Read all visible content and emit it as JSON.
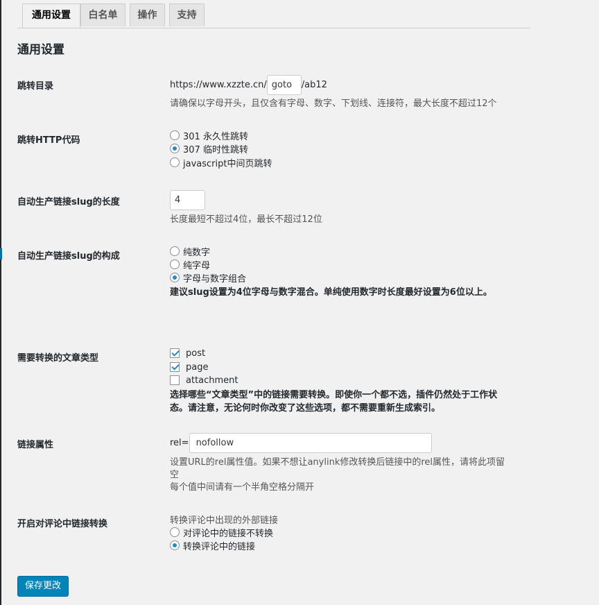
{
  "tabs": [
    {
      "label": "通用设置"
    },
    {
      "label": "白名单"
    },
    {
      "label": "操作"
    },
    {
      "label": "支持"
    }
  ],
  "page_title": "通用设置",
  "redirect_dir": {
    "label": "跳转目录",
    "prefix": "https://www.xzzte.cn/",
    "value": "goto",
    "suffix": "/ab12",
    "hint": "请确保以字母开头，且仅含有字母、数字、下划线、连接符，最大长度不超过12个"
  },
  "http_code": {
    "label": "跳转HTTP代码",
    "options": [
      {
        "label": "301 永久性跳转",
        "checked": false
      },
      {
        "label": "307 临时性跳转",
        "checked": true
      },
      {
        "label": "javascript中间页跳转",
        "checked": false
      }
    ]
  },
  "slug_length": {
    "label": "自动生产链接slug的长度",
    "value": "4",
    "hint": "长度最短不超过4位，最长不超过12位"
  },
  "slug_compose": {
    "label": "自动生产链接slug的构成",
    "options": [
      {
        "label": "纯数字",
        "checked": false
      },
      {
        "label": "纯字母",
        "checked": false
      },
      {
        "label": "字母与数字组合",
        "checked": true
      }
    ],
    "hint": "建议slug设置为4位字母与数字混合。单纯使用数字时长度最好设置为6位以上。"
  },
  "post_types": {
    "label": "需要转换的文章类型",
    "options": [
      {
        "label": "post",
        "checked": true
      },
      {
        "label": "page",
        "checked": true
      },
      {
        "label": "attachment",
        "checked": false
      }
    ],
    "hint_line1": "选择哪些“文章类型”中的链接需要转换。即使你一个都不选，插件仍然处于工作状",
    "hint_line2": "态。请注意，无论何时你改变了这些选项，都不需要重新生成索引。"
  },
  "link_rel": {
    "label": "链接属性",
    "prefix": "rel=",
    "value": "nofollow",
    "hint_line1": "设置URL的rel属性值。如果不想让anylink修改转换后链接中的rel属性，请将此项留",
    "hint_line2": "空",
    "hint_line3": "每个值中间请有一个半角空格分隔开"
  },
  "comment_links": {
    "label": "开启对评论中链接转换",
    "intro": "转换评论中出现的外部链接",
    "options": [
      {
        "label": "对评论中的链接不转换",
        "checked": false
      },
      {
        "label": "转换评论中的链接",
        "checked": true
      }
    ]
  },
  "save_label": "保存更改"
}
